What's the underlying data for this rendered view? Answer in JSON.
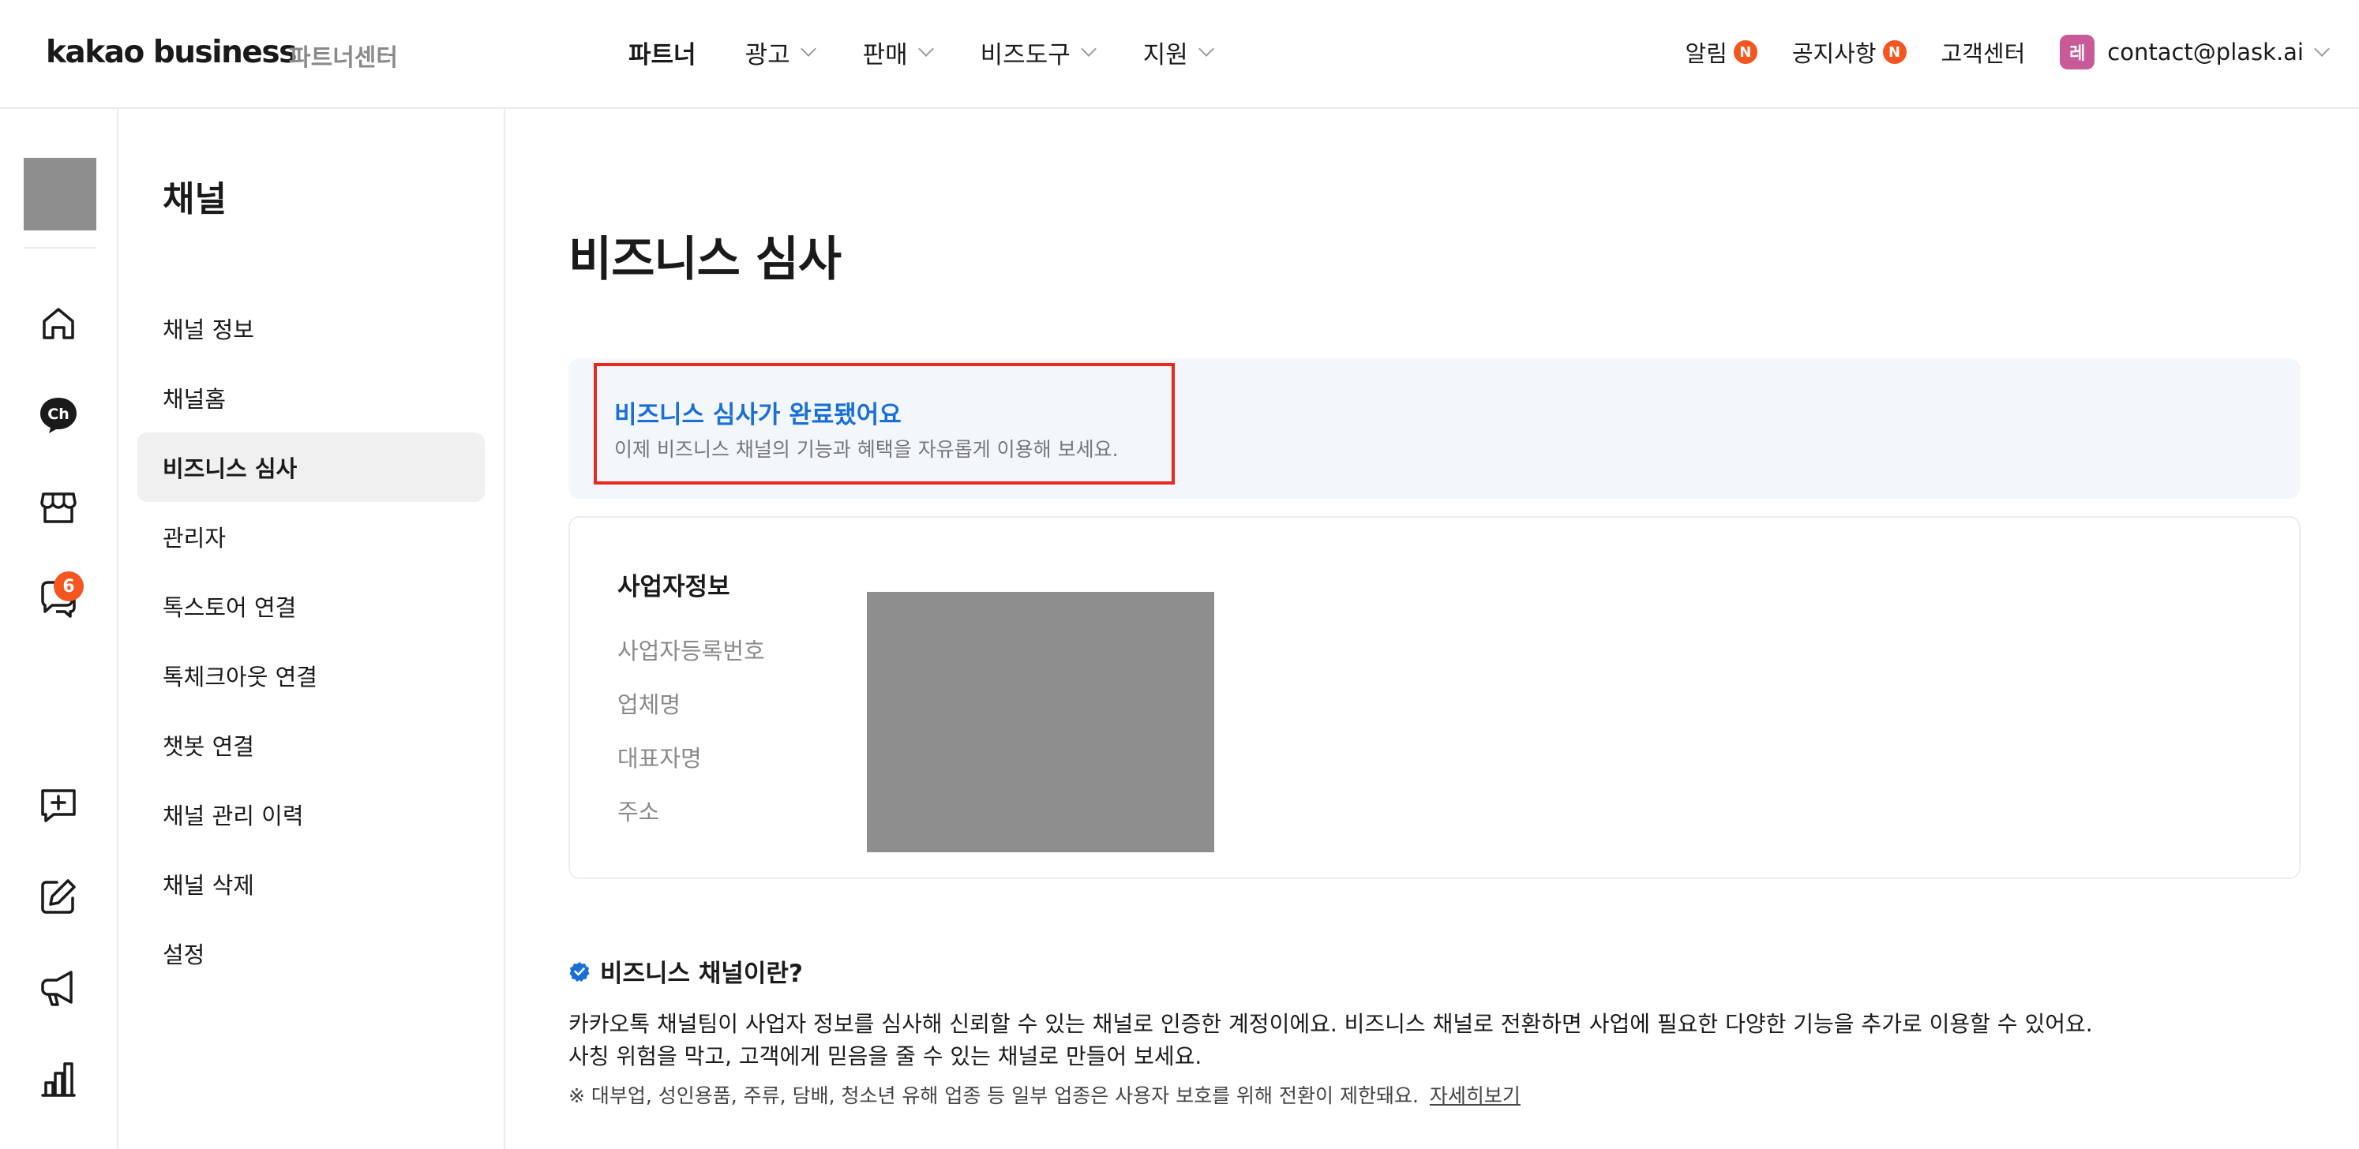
{
  "header": {
    "logo": "kakao business",
    "logo_sub": "파트너센터",
    "nav": [
      {
        "label": "파트너"
      },
      {
        "label": "광고"
      },
      {
        "label": "판매"
      },
      {
        "label": "비즈도구"
      },
      {
        "label": "지원"
      }
    ],
    "alerts": {
      "label": "알림",
      "badge": "N"
    },
    "notices": {
      "label": "공지사항",
      "badge": "N"
    },
    "support": {
      "label": "고객센터"
    },
    "account": {
      "avatar_text": "레",
      "email": "contact@plask.ai"
    }
  },
  "rail": {
    "chat_badge": "6"
  },
  "submenu": {
    "title": "채널",
    "items": [
      {
        "label": "채널 정보"
      },
      {
        "label": "채널홈"
      },
      {
        "label": "비즈니스 심사"
      },
      {
        "label": "관리자"
      },
      {
        "label": "톡스토어 연결"
      },
      {
        "label": "톡체크아웃 연결"
      },
      {
        "label": "챗봇 연결"
      },
      {
        "label": "채널 관리 이력"
      },
      {
        "label": "채널 삭제"
      },
      {
        "label": "설정"
      }
    ]
  },
  "main": {
    "title": "비즈니스 심사",
    "notice": {
      "title": "비즈니스 심사가 완료됐어요",
      "desc": "이제 비즈니스 채널의 기능과 혜택을 자유롭게 이용해 보세요."
    },
    "business_info": {
      "title": "사업자정보",
      "labels": [
        "사업자등록번호",
        "업체명",
        "대표자명",
        "주소"
      ]
    },
    "about": {
      "heading": "비즈니스 채널이란?",
      "line1": "카카오톡 채널팀이 사업자 정보를 심사해 신뢰할 수 있는 채널로 인증한 계정이에요. 비즈니스 채널로 전환하면 사업에 필요한 다양한 기능을 추가로 이용할 수 있어요.",
      "line2": "사칭 위험을 막고, 고객에게 믿음을 줄 수 있는 채널로 만들어 보세요.",
      "note": "※ 대부업, 성인용품, 주류, 담배, 청소년 유해 업종 등 일부 업종은 사용자 보호를 위해 전환이 제한돼요.",
      "link": "자세히보기"
    }
  },
  "colors": {
    "accent_blue": "#1a6fd6",
    "badge_orange": "#f5561f",
    "highlight_red": "#e8291c",
    "notice_bg": "#f3f7fc"
  }
}
